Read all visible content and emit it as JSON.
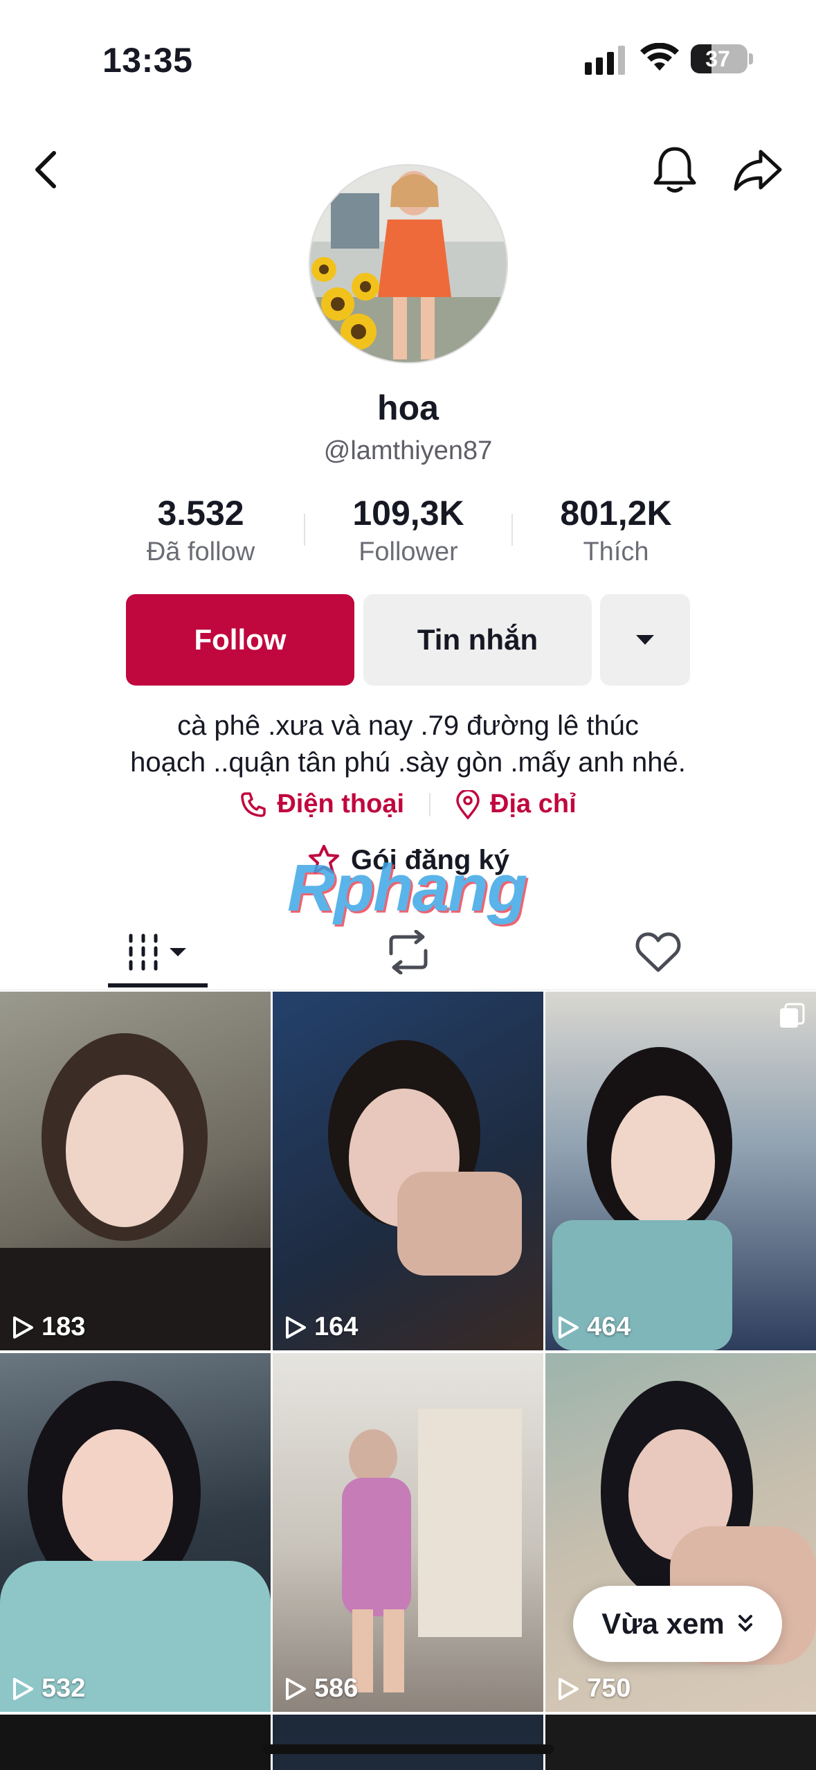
{
  "status": {
    "time": "13:35",
    "battery": "37"
  },
  "profile": {
    "name": "hoa",
    "handle": "@lamthiyen87",
    "stats": [
      {
        "value": "3.532",
        "label": "Đã follow"
      },
      {
        "value": "109,3K",
        "label": "Follower"
      },
      {
        "value": "801,2K",
        "label": "Thích"
      }
    ],
    "buttons": {
      "follow": "Follow",
      "message": "Tin nhắn"
    },
    "bio_line1": "cà phê .xưa và nay .79 đường lê thúc",
    "bio_line2": "hoạch ..quận tân phú .sày gòn .mấy anh nhé.",
    "phone_label": "Điện thoại",
    "address_label": "Địa chỉ",
    "subscription_label": "Gói đăng ký",
    "watermark": "Rphang"
  },
  "tabs": [
    {
      "icon": "grid-icon",
      "active": true
    },
    {
      "icon": "repost-icon",
      "active": false
    },
    {
      "icon": "heart-icon",
      "active": false
    }
  ],
  "videos": [
    {
      "views": "183",
      "bg": "#8a8a7e"
    },
    {
      "views": "164",
      "bg": "#2c3f5e"
    },
    {
      "views": "464",
      "bg": "#7b8ea3"
    },
    {
      "views": "532",
      "bg": "#3b4a55"
    },
    {
      "views": "586",
      "bg": "#c9c4bd"
    },
    {
      "views": "750",
      "bg": "#8fa3a0"
    }
  ],
  "recent_button": "Vừa xem",
  "colors": {
    "accent": "#c0073e",
    "text": "#161823",
    "secondary": "#5d5e66",
    "button_gray": "#efefef"
  }
}
